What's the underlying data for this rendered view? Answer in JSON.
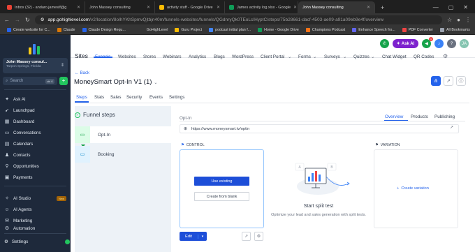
{
  "browser": {
    "tabs": [
      {
        "label": "Inbox (32) - andaro.jameslf@g",
        "color": "#ea4335"
      },
      {
        "label": "John Massey consulting",
        "color": "#3b82f6"
      },
      {
        "label": "activity stuff - Google Drive",
        "color": "#fbbc04"
      },
      {
        "label": "James activity log.xlsx - Google",
        "color": "#0f9d58"
      },
      {
        "label": "John Massey consulting",
        "color": "#3b82f6"
      }
    ],
    "url_host": "app.gohighlevel.com",
    "url_path": "/v2/location/8oIhYKhSpmvQjtbjn40m/funnels-websites/funnels/QGdnryQk0TEoLcIHyptC/steps/75b28661-dacf-4503-ae09-a91a09eb9e4f/overview",
    "bookmarks": [
      {
        "label": "Create website for C...",
        "color": "#2563eb"
      },
      {
        "label": "Claude",
        "color": "#d97706"
      },
      {
        "label": "Claude Design Requ...",
        "color": "#2563eb"
      },
      {
        "label": "GoHighLevel",
        "color": "#9ca3af"
      },
      {
        "label": "Guru Project",
        "color": "#fbbc04"
      },
      {
        "label": "podcast initial plan f...",
        "color": "#4285f4"
      },
      {
        "label": "Home - Google Drive",
        "color": "#0f9d58"
      },
      {
        "label": "Champions Podcast",
        "color": "#f97316"
      },
      {
        "label": "Enhance Speech fro...",
        "color": "#6366f1"
      },
      {
        "label": "PDF Converter",
        "color": "#ef4444"
      }
    ],
    "all_bookmarks": "All Bookmarks"
  },
  "sidebar": {
    "account_name": "John Massey consul...",
    "account_location": "Tarpon Springs, Florida",
    "search_placeholder": "Search",
    "search_shortcut": "ctrl K",
    "nav": [
      {
        "label": "Ask AI",
        "icon": "sparkle-icon"
      },
      {
        "label": "Launchpad",
        "icon": "rocket-icon"
      },
      {
        "label": "Dashboard",
        "icon": "dashboard-icon"
      },
      {
        "label": "Conversations",
        "icon": "chat-icon"
      },
      {
        "label": "Calendars",
        "icon": "calendar-icon"
      },
      {
        "label": "Contacts",
        "icon": "contacts-icon"
      },
      {
        "label": "Opportunities",
        "icon": "funnel-icon"
      },
      {
        "label": "Payments",
        "icon": "card-icon"
      }
    ],
    "nav2": [
      {
        "label": "AI Studio",
        "icon": "ai-studio-icon",
        "badge": "New"
      },
      {
        "label": "AI Agents",
        "icon": "agent-icon"
      },
      {
        "label": "Marketing",
        "icon": "megaphone-icon"
      },
      {
        "label": "Automation",
        "icon": "automation-icon"
      }
    ],
    "settings": "Settings"
  },
  "header": {
    "section": "Sites",
    "nav": [
      "Funnels",
      "Websites",
      "Stores",
      "Webinars",
      "Analytics",
      "Blogs",
      "WordPress",
      "Client Portal",
      "Forms",
      "Surveys",
      "Quizzes",
      "Chat Widget",
      "QR Codes"
    ],
    "ask_ai": "Ask AI",
    "avatar_initials": "JA",
    "notification_count": "1"
  },
  "page": {
    "back": "Back",
    "title": "MoneySmart Opt-In V1 (1)",
    "subtabs": [
      "Steps",
      "Stats",
      "Sales",
      "Security",
      "Events",
      "Settings"
    ]
  },
  "funnel": {
    "heading": "Funnel steps",
    "steps": [
      "Opt-In",
      "Booking"
    ]
  },
  "step_detail": {
    "label": "Opt-In",
    "tabs": [
      "Overview",
      "Products",
      "Publishing"
    ],
    "url": "https://www.moneysmart.tv/optin",
    "control_label": "CONTROL",
    "variation_label": "VARIATION",
    "use_existing": "Use existing",
    "create_from_blank": "Create from blank",
    "edit": "Edit",
    "split_title": "Start split test",
    "split_desc": "Optimize your lead and sales generation with split tests.",
    "create_variation": "Create variation",
    "illustration_letters": [
      "A",
      "B"
    ]
  }
}
